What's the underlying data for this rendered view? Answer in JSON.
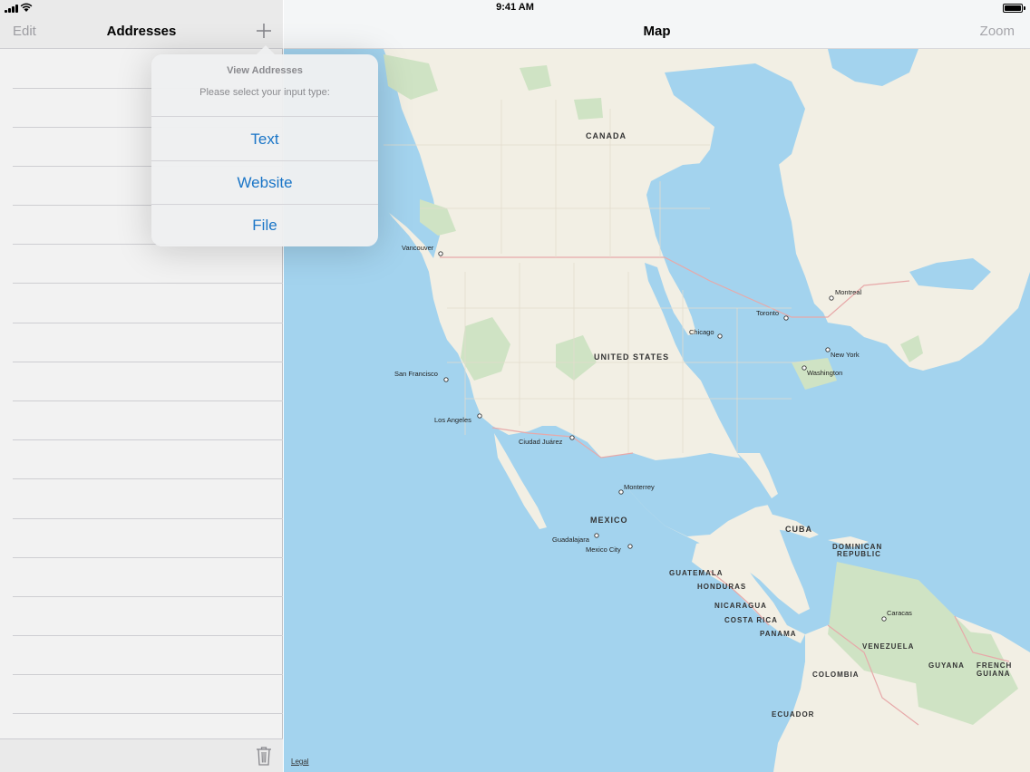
{
  "status_bar": {
    "time": "9:41 AM"
  },
  "master": {
    "edit_label": "Edit",
    "title": "Addresses",
    "add_icon": "plus-icon",
    "trash_icon": "trash-icon"
  },
  "detail": {
    "title": "Map",
    "zoom_label": "Zoom",
    "legal_label": "Legal"
  },
  "popover": {
    "title": "View Addresses",
    "message": "Please select your input type:",
    "options": [
      {
        "label": "Text"
      },
      {
        "label": "Website"
      },
      {
        "label": "File"
      }
    ]
  },
  "map": {
    "countries": [
      "CANADA",
      "UNITED STATES",
      "MEXICO",
      "CUBA",
      "DOMINICAN",
      "REPUBLIC",
      "GUATEMALA",
      "HONDURAS",
      "NICARAGUA",
      "COSTA RICA",
      "PANAMA",
      "VENEZUELA",
      "GUYANA",
      "FRENCH",
      "GUIANA",
      "COLOMBIA",
      "ECUADOR"
    ],
    "cities": [
      "Vancouver",
      "Montreal",
      "Toronto",
      "Chicago",
      "New York",
      "Washington",
      "San Francisco",
      "Los Angeles",
      "Ciudad Juárez",
      "Monterrey",
      "Guadalajara",
      "Mexico City",
      "Caracas"
    ],
    "colors": {
      "water": "#a3d3ee",
      "land": "#f2efe4",
      "park": "#cfe3c4",
      "border": "#e7a9a9"
    }
  }
}
